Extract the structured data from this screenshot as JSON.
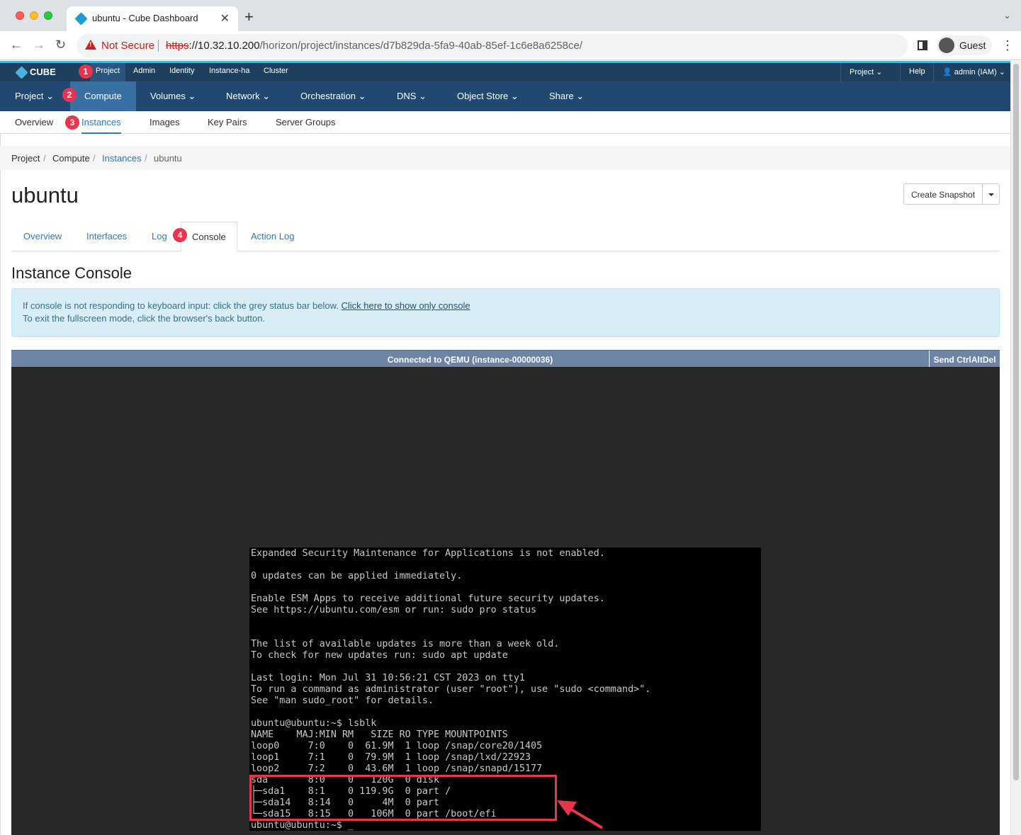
{
  "browser": {
    "tab_title": "ubuntu - Cube Dashboard",
    "tab_close": "✕",
    "new_tab": "+",
    "tab_menu": "⌄",
    "back": "←",
    "forward": "→",
    "reload": "↻",
    "security_label": "Not Secure",
    "url_scheme": "https",
    "url_host": "://10.32.10.200",
    "url_path": "/horizon/project/instances/d7b829da-5fa9-40ab-85ef-1c6e8a6258ce/",
    "profile_name": "Guest",
    "menu": "⋮"
  },
  "topnav": {
    "logo": "CUBE",
    "items": [
      "Project",
      "Admin",
      "Identity",
      "Instance-ha",
      "Cluster"
    ],
    "right": [
      "Project ⌄",
      "Help",
      "admin (IAM) ⌄"
    ]
  },
  "secnav": {
    "items": [
      "Project ⌄",
      "Compute",
      "Volumes ⌄",
      "Network ⌄",
      "Orchestration ⌄",
      "DNS ⌄",
      "Object Store ⌄",
      "Share ⌄"
    ]
  },
  "tertnav": {
    "items": [
      "Overview",
      "Instances",
      "Images",
      "Key Pairs",
      "Server Groups"
    ]
  },
  "breadcrumb": {
    "items": [
      "Project",
      "Compute",
      "Instances",
      "ubuntu"
    ],
    "sep": "/"
  },
  "page": {
    "title": "ubuntu",
    "snapshot_button": "Create Snapshot"
  },
  "detail_tabs": [
    "Overview",
    "Interfaces",
    "Log",
    "Console",
    "Action Log"
  ],
  "console": {
    "title": "Instance Console",
    "info_line1": "If console is not responding to keyboard input: click the grey status bar below.",
    "info_link": "Click here to show only console",
    "info_line2": "To exit the fullscreen mode, click the browser's back button.",
    "status": "Connected to QEMU (instance-00000036)",
    "send_cad": "Send CtrlAltDel",
    "terminal_text": "Expanded Security Maintenance for Applications is not enabled.\n\n0 updates can be applied immediately.\n\nEnable ESM Apps to receive additional future security updates.\nSee https://ubuntu.com/esm or run: sudo pro status\n\n\nThe list of available updates is more than a week old.\nTo check for new updates run: sudo apt update\n\nLast login: Mon Jul 31 10:56:21 CST 2023 on tty1\nTo run a command as administrator (user \"root\"), use \"sudo <command>\".\nSee \"man sudo_root\" for details.\n\nubuntu@ubuntu:~$ lsblk\nNAME    MAJ:MIN RM   SIZE RO TYPE MOUNTPOINTS\nloop0     7:0    0  61.9M  1 loop /snap/core20/1405\nloop1     7:1    0  79.9M  1 loop /snap/lxd/22923\nloop2     7:2    0  43.6M  1 loop /snap/snapd/15177\nsda       8:0    0   120G  0 disk\n├─sda1    8:1    0 119.9G  0 part /\n├─sda14   8:14   0     4M  0 part\n└─sda15   8:15   0   106M  0 part /boot/efi\nubuntu@ubuntu:~$ _"
  },
  "badges": [
    "1",
    "2",
    "3",
    "4"
  ],
  "colors": {
    "accent": "#e8344d",
    "nav_dark": "#1f3f5f",
    "link": "#2b7bbf"
  }
}
